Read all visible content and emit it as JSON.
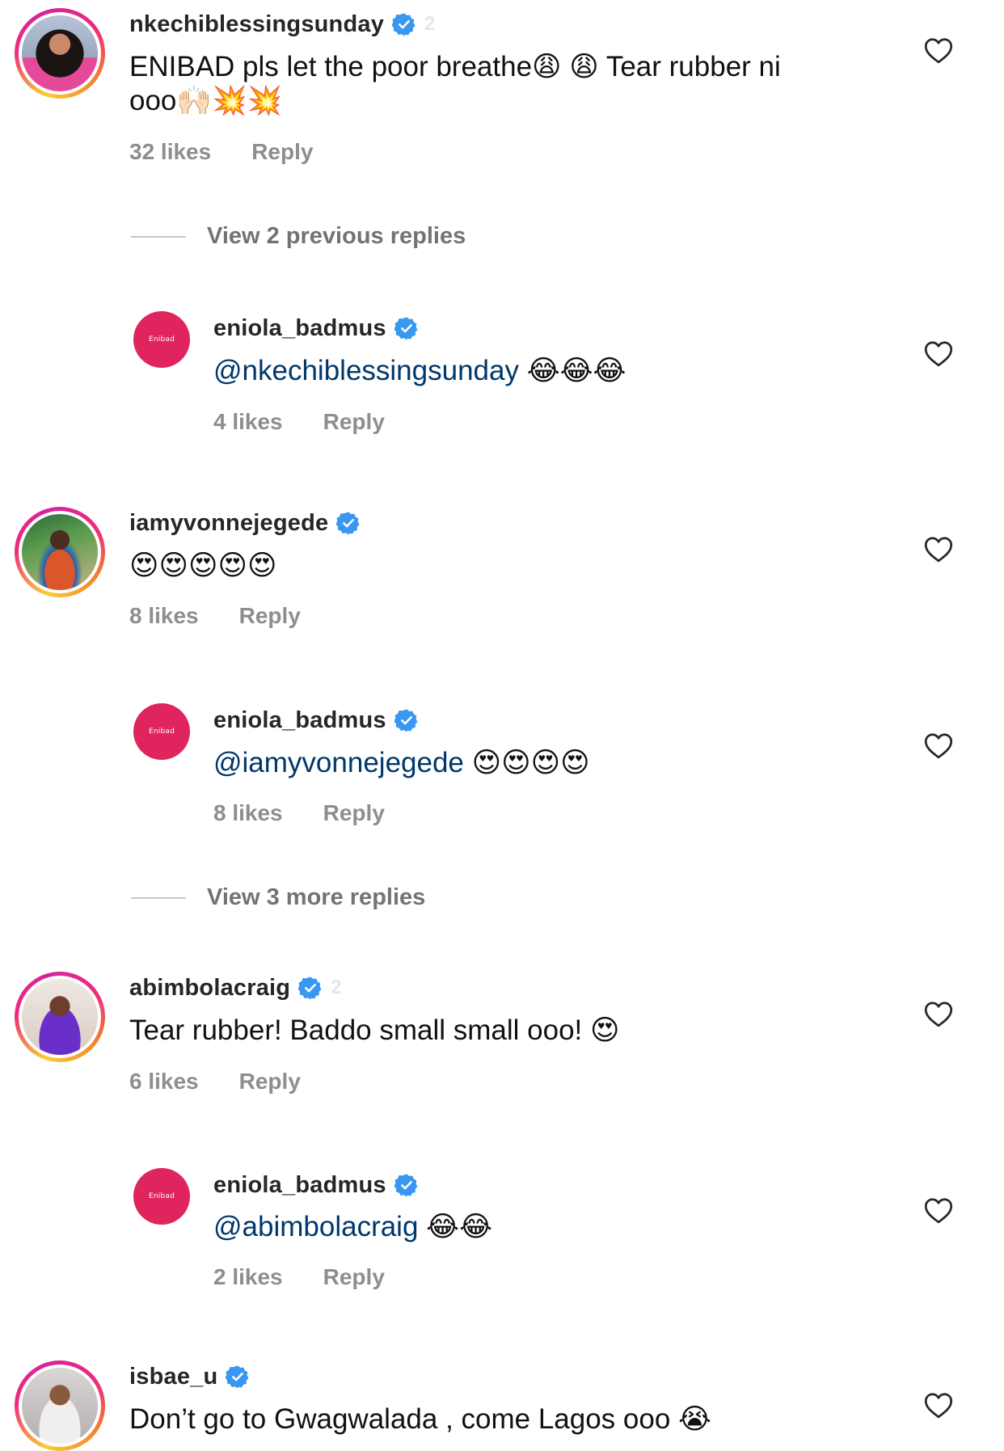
{
  "comments": [
    {
      "username": "nkechiblessingsunday",
      "time": "2",
      "text_line1": "ENIBAD pls let the poor breathe😩 😩 Tear rubber ni",
      "text_line2": "ooo🙌🏻💥💥",
      "likes": "32 likes",
      "reply": "Reply"
    },
    {
      "username": "iamyvonnejegede",
      "text": "😍😍😍😍😍",
      "likes": "8 likes",
      "reply": "Reply"
    },
    {
      "username": "abimbolacraig",
      "time": "2",
      "text": "Tear rubber! Baddo small small ooo! 😍",
      "likes": "6 likes",
      "reply": "Reply"
    },
    {
      "username": "isbae_u",
      "text": "Don’t go to Gwagwalada , come Lagos ooo 😭"
    }
  ],
  "replies": [
    {
      "username": "eniola_badmus",
      "mention": "@nkechiblessingsunday",
      "emoji": "😂😂😂",
      "likes": "4 likes",
      "reply": "Reply",
      "logo": "Enibad"
    },
    {
      "username": "eniola_badmus",
      "mention": "@iamyvonnejegede",
      "emoji": "😍😍😍😍",
      "likes": "8 likes",
      "reply": "Reply",
      "logo": "Enibad"
    },
    {
      "username": "eniola_badmus",
      "mention": "@abimbolacraig",
      "emoji": "😂😂",
      "likes": "2 likes",
      "reply": "Reply",
      "logo": "Enibad"
    }
  ],
  "view_previous": "View 2 previous replies",
  "view_more": "View 3 more replies",
  "colors": {
    "verified": "#3897f0",
    "brand": "#e0245e",
    "mention": "#00376b",
    "meta": "#8e8e8e"
  },
  "icons": [
    "heart-icon",
    "verified-badge-icon"
  ]
}
